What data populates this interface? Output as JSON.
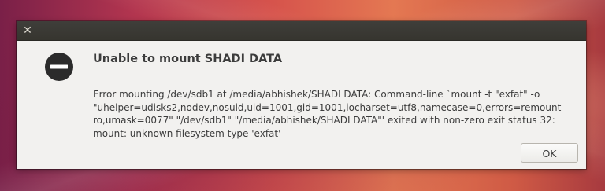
{
  "dialog": {
    "close_icon_glyph": "✕",
    "icon": "dialog-error-icon",
    "title": "Unable to mount SHADI DATA",
    "message": "Error mounting /dev/sdb1 at /media/abhishek/SHADI DATA: Command-line `mount -t \"exfat\" -o \"uhelper=udisks2,nodev,nosuid,uid=1001,gid=1001,iocharset=utf8,namecase=0,errors=remount-ro,umask=0077\" \"/dev/sdb1\" \"/media/abhishek/SHADI DATA\"' exited with non-zero exit status 32: mount: unknown filesystem type 'exfat'",
    "ok_label": "OK"
  },
  "colors": {
    "titlebar": "#3c3b37",
    "dialog_background": "#f2f1ef",
    "text": "#3c3c3c"
  }
}
